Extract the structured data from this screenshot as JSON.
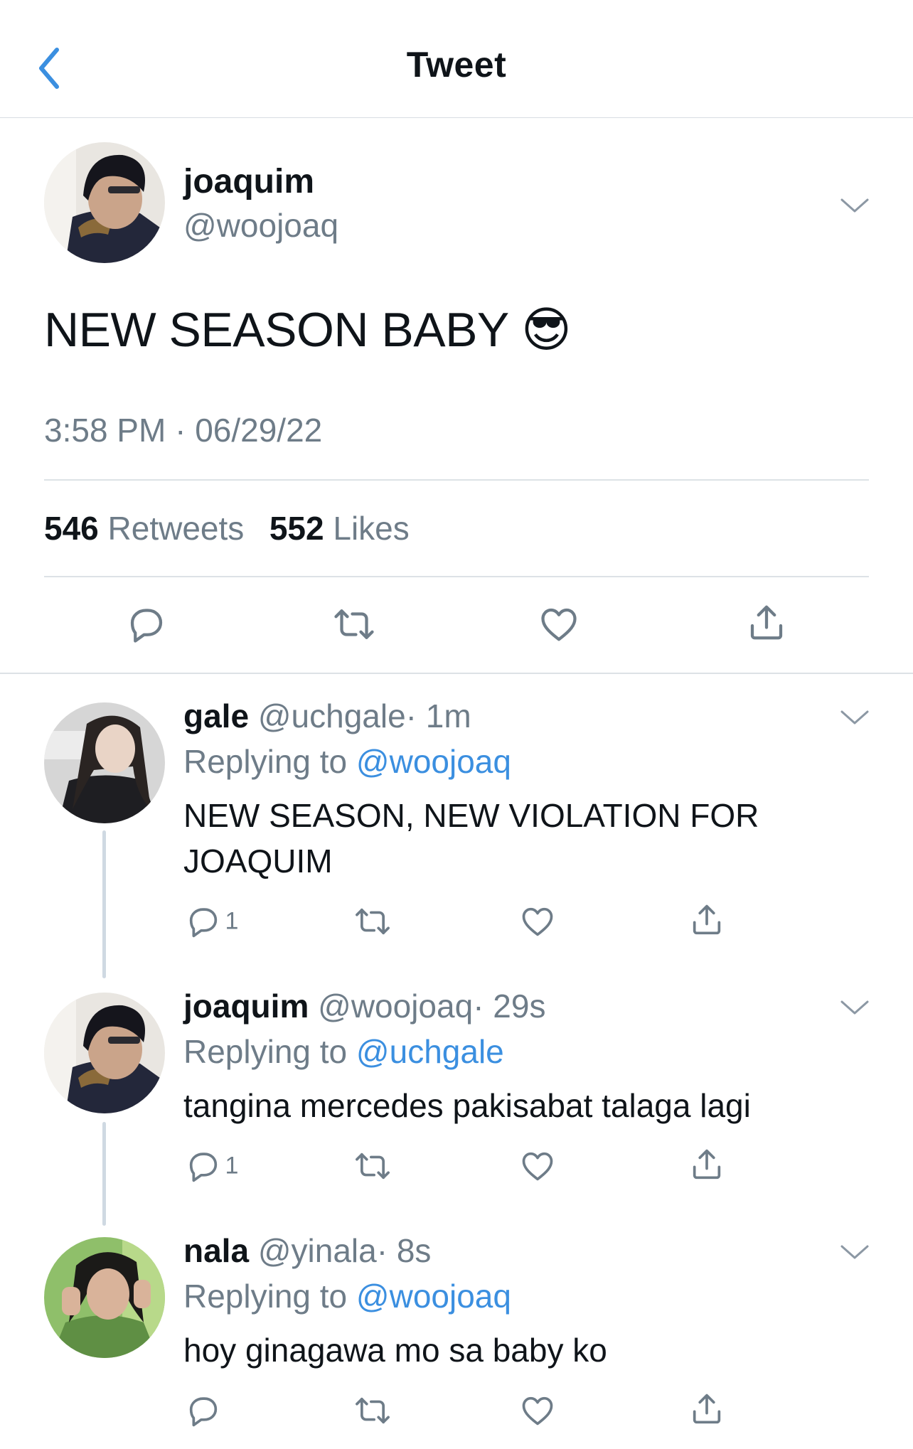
{
  "header": {
    "title": "Tweet"
  },
  "main_tweet": {
    "display_name": "joaquim",
    "handle": "@woojoaq",
    "text": "NEW SEASON BABY 😎",
    "timestamp": "3:58 PM · 06/29/22",
    "stats": {
      "retweets_count": "546",
      "retweets_label": "Retweets",
      "likes_count": "552",
      "likes_label": "Likes"
    }
  },
  "replies": [
    {
      "display_name": "gale",
      "handle": "@uchgale",
      "time": "· 1m",
      "replying_prefix": "Replying to",
      "replying_to": "@woojoaq",
      "text_line1": "NEW SEASON, NEW VIOLATION FOR",
      "text_line2": "JOAQUIM",
      "reply_count": "1"
    },
    {
      "display_name": "joaquim",
      "handle": "@woojoaq",
      "time": "· 29s",
      "replying_prefix": "Replying to",
      "replying_to": "@uchgale",
      "text_line1": "tangina mercedes pakisabat talaga lagi",
      "reply_count": "1"
    },
    {
      "display_name": "nala",
      "handle": "@yinala",
      "time": "· 8s",
      "replying_prefix": "Replying to",
      "replying_to": "@woojoaq",
      "text_line1": "hoy ginagawa mo sa baby ko"
    }
  ],
  "icons": {
    "back": "chevron-left-icon",
    "menu": "chevron-down-icon",
    "reply": "speech-bubble-icon",
    "retweet": "retweet-arrows-icon",
    "like": "heart-icon",
    "share": "share-upload-icon"
  },
  "colors": {
    "accent": "#3b8fe0",
    "secondary_text": "#6e7c88",
    "divider": "#dde2e6"
  }
}
